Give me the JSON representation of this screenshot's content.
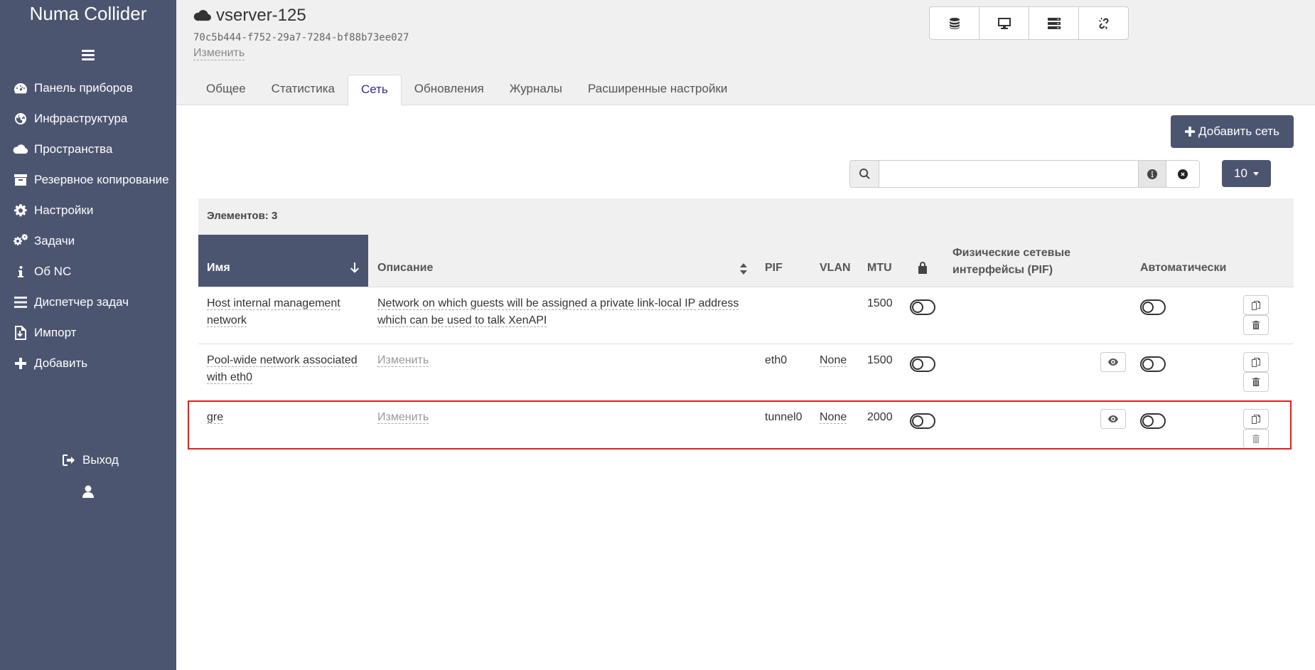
{
  "sidebar": {
    "brand": "Numa Collider",
    "items": [
      {
        "label": "Панель приборов",
        "icon": "dashboard-icon"
      },
      {
        "label": "Инфраструктура",
        "icon": "globe-icon"
      },
      {
        "label": "Пространства",
        "icon": "cloud-icon"
      },
      {
        "label": "Резервное копирование",
        "icon": "archive-icon"
      },
      {
        "label": "Настройки",
        "icon": "gear-icon"
      },
      {
        "label": "Задачи",
        "icon": "gears-icon"
      },
      {
        "label": "Об NC",
        "icon": "info-icon"
      },
      {
        "label": "Диспетчер задач",
        "icon": "tasks-icon"
      },
      {
        "label": "Импорт",
        "icon": "import-icon"
      },
      {
        "label": "Добавить",
        "icon": "plus-icon"
      }
    ],
    "logout_label": "Выход"
  },
  "header": {
    "vm_name": "vserver-125",
    "vm_uuid": "70c5b444-f752-29a7-7284-bf88b73ee027",
    "edit_label": "Изменить",
    "toolbar_icons": [
      "database-icon",
      "console-icon",
      "server-list-icon",
      "unlink-icon"
    ],
    "tabs": [
      {
        "label": "Общее",
        "active": false
      },
      {
        "label": "Статистика",
        "active": false
      },
      {
        "label": "Сеть",
        "active": true
      },
      {
        "label": "Обновления",
        "active": false
      },
      {
        "label": "Журналы",
        "active": false
      },
      {
        "label": "Расширенные настройки",
        "active": false
      }
    ]
  },
  "main": {
    "add_network_label": "Добавить сеть",
    "search": {
      "value": "",
      "placeholder": ""
    },
    "page_size": "10",
    "items_count": "Элементов: 3",
    "columns": {
      "name": "Имя",
      "description": "Описание",
      "pif": "PIF",
      "vlan": "VLAN",
      "mtu": "MTU",
      "lock_icon": "lock-icon",
      "pifs": "Физические сетевые интерфейсы (PIF)",
      "auto": "Автоматически"
    },
    "rows": [
      {
        "name": "Host internal management network",
        "description": "Network on which guests will be assigned a private link-local IP address which can be used to talk XenAPI",
        "pif": "",
        "vlan": "",
        "mtu": "1500"
      },
      {
        "name": "Pool-wide network associated with eth0",
        "description": "Изменить",
        "pif": "eth0",
        "vlan": "None",
        "mtu": "1500"
      },
      {
        "name": "gre",
        "description": "Изменить",
        "pif": "tunnel0",
        "vlan": "None",
        "mtu": "2000"
      }
    ]
  },
  "colors": {
    "sidebar_bg": "#4c5570",
    "active_tab_text": "#3a2a8c",
    "highlight_border": "#e02020"
  }
}
